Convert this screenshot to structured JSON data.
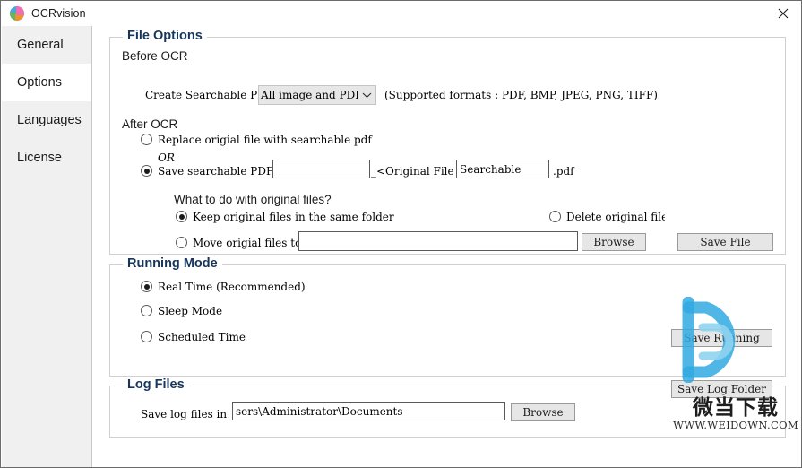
{
  "window": {
    "title": "OCRvision",
    "app_icon": "ocrvision-logo-icon",
    "close_icon": "close-icon"
  },
  "sidebar": {
    "items": [
      {
        "label": "General",
        "selected": false
      },
      {
        "label": "Options",
        "selected": true
      },
      {
        "label": "Languages",
        "selected": false
      },
      {
        "label": "License",
        "selected": false
      }
    ]
  },
  "file_options": {
    "title": "File Options",
    "before_ocr": {
      "heading": "Before OCR",
      "create_label": "Create Searchable PDF from",
      "format_combo": {
        "value": "All image and PDF files",
        "arrow_icon": "chevron-down-icon"
      },
      "supported_formats": "(Supported formats : PDF, BMP, JPEG, PNG, TIFF)"
    },
    "after_ocr": {
      "heading": "After OCR",
      "replace_option": {
        "label": "Replace origial file with searchable pdf",
        "checked": false
      },
      "or_text": "OR",
      "save_option": {
        "label": "Save searchable PDF as",
        "checked": true,
        "prefix_value": "",
        "middle_label": "_<Original File Name>_",
        "suffix_value": "Searchable",
        "extension_label": ".pdf"
      }
    },
    "original_files": {
      "question": "What to do with original files?",
      "keep_option": {
        "label": "Keep original files in the same folder",
        "checked": true
      },
      "delete_option": {
        "label": "Delete original files",
        "checked": false
      },
      "move_option": {
        "label": "Move origial files to",
        "checked": false
      },
      "move_path_value": "",
      "browse_label": "Browse",
      "save_label": "Save File"
    }
  },
  "running_mode": {
    "title": "Running Mode",
    "options": [
      {
        "label": "Real Time (Recommended)",
        "checked": true
      },
      {
        "label": "Sleep Mode",
        "checked": false
      },
      {
        "label": "Scheduled Time",
        "checked": false
      }
    ],
    "save_label": "Save Running"
  },
  "log_files": {
    "title": "Log Files",
    "save_label": "Save log files in",
    "path_value": "sers\\Administrator\\Documents",
    "browse_label": "Browse",
    "save_folder_label": "Save Log Folder"
  },
  "watermark": {
    "logo": "weidown-d-logo",
    "chinese_text": "微当下载",
    "url_text": "WWW.WEIDOWN.COM",
    "color": "#31a9e0"
  }
}
